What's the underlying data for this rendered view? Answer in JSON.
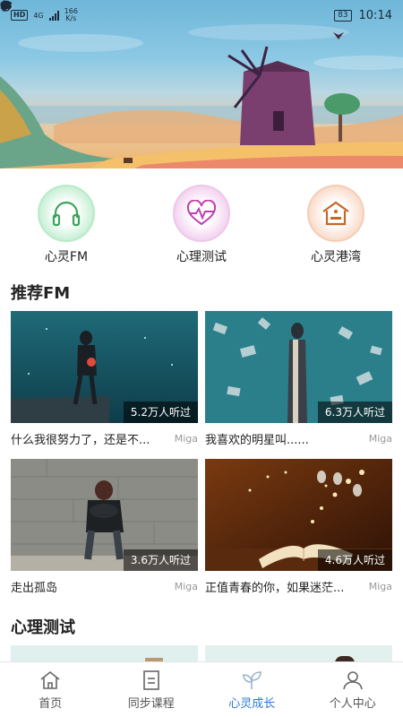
{
  "status_bar": {
    "hd": "HD",
    "network": "4G",
    "speed_value": "166",
    "speed_unit": "K/s",
    "battery": "83",
    "time": "10:14"
  },
  "categories": [
    {
      "label": "心灵FM",
      "icon": "headphones-icon",
      "color": "#3aa55a"
    },
    {
      "label": "心理测试",
      "icon": "heart-pulse-icon",
      "color": "#c03db0"
    },
    {
      "label": "心灵港湾",
      "icon": "house-icon",
      "color": "#c8662a"
    }
  ],
  "recommended_fm": {
    "title": "推荐FM",
    "items": [
      {
        "title": "什么我很努力了，还是不...",
        "author": "Miga",
        "listens": "5.2万人听过"
      },
      {
        "title": "我喜欢的明星叫......",
        "author": "Miga",
        "listens": "6.3万人听过"
      },
      {
        "title": "走出孤岛",
        "author": "Miga",
        "listens": "3.6万人听过"
      },
      {
        "title": "正值青春的你，如果迷茫...",
        "author": "Miga",
        "listens": "4.6万人听过"
      }
    ]
  },
  "psych_test": {
    "title": "心理测试"
  },
  "bottom_nav": {
    "items": [
      {
        "label": "首页",
        "icon": "home-icon"
      },
      {
        "label": "同步课程",
        "icon": "document-icon"
      },
      {
        "label": "心灵成长",
        "icon": "sprout-icon",
        "active": true
      },
      {
        "label": "个人中心",
        "icon": "person-icon"
      }
    ],
    "active_color": "#2d78d6"
  }
}
